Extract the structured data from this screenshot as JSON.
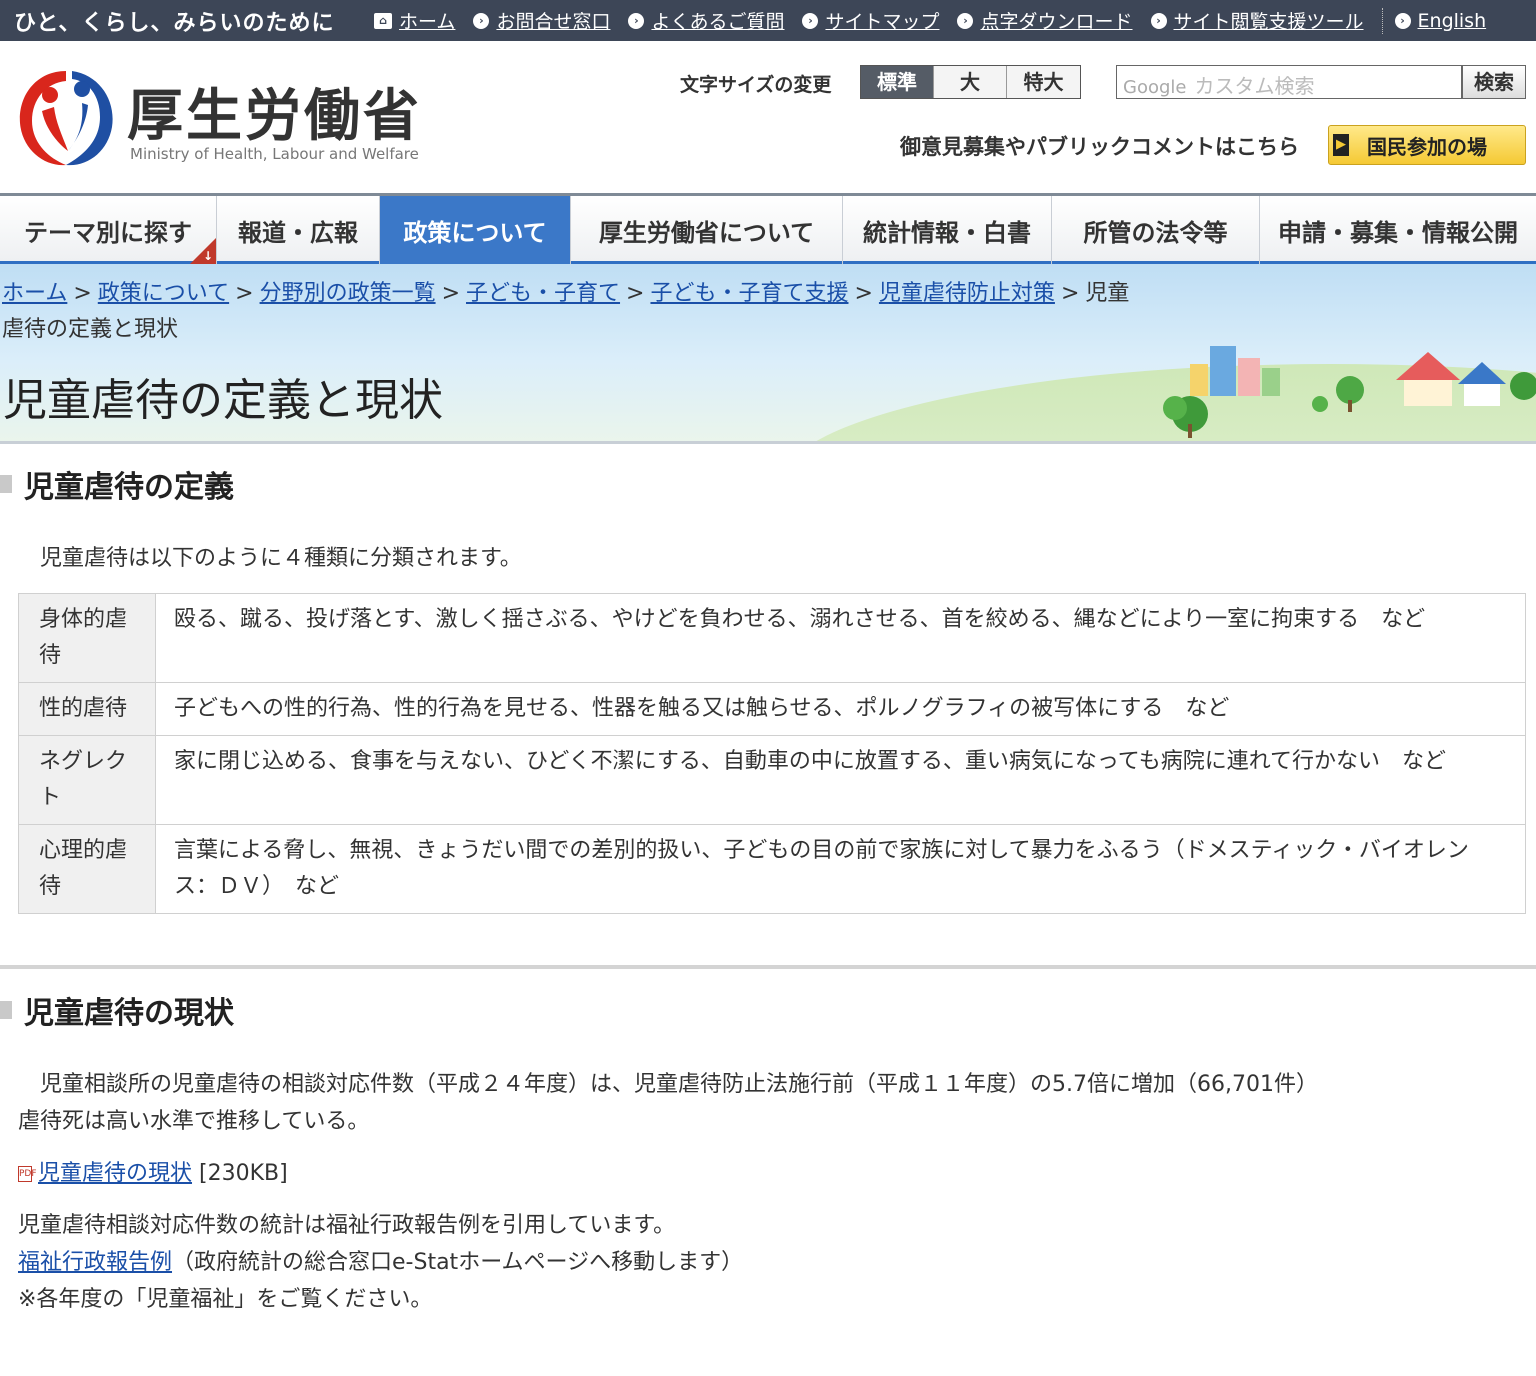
{
  "topbar": {
    "slogan": "ひと、くらし、みらいのために",
    "links": [
      {
        "label": "ホーム",
        "icon": "home-icon"
      },
      {
        "label": "お問合せ窓口",
        "icon": "circle-arrow-icon"
      },
      {
        "label": "よくあるご質問",
        "icon": "circle-arrow-icon"
      },
      {
        "label": "サイトマップ",
        "icon": "circle-arrow-icon"
      },
      {
        "label": "点字ダウンロード",
        "icon": "circle-arrow-icon"
      },
      {
        "label": "サイト閲覧支援ツール",
        "icon": "circle-arrow-icon"
      }
    ],
    "english": "English"
  },
  "header": {
    "title": "厚生労働省",
    "subtitle": "Ministry of Health, Labour and Welfare",
    "fontsize_label": "文字サイズの変更",
    "fontsize_options": [
      "標準",
      "大",
      "特大"
    ],
    "fontsize_selected": "標準",
    "search_brand": "Google",
    "search_placeholder": "カスタム検索",
    "search_button": "検索",
    "comment_text": "御意見募集やパブリックコメントはこちら",
    "kokumin_button": "国民参加の場"
  },
  "nav": {
    "items": [
      "テーマ別に探す",
      "報道・広報",
      "政策について",
      "厚生労働省について",
      "統計情報・白書",
      "所管の法令等",
      "申請・募集・情報公開"
    ],
    "active": "政策について"
  },
  "breadcrumb": {
    "links": [
      "ホーム",
      "政策について",
      "分野別の政策一覧",
      "子ども・子育て",
      "子ども・子育て支援",
      "児童虐待防止対策"
    ],
    "current": "児童虐待の定義と現状"
  },
  "page_title": "児童虐待の定義と現状",
  "section1": {
    "heading": "児童虐待の定義",
    "intro": "児童虐待は以下のように４種類に分類されます。",
    "rows": [
      {
        "type": "身体的虐待",
        "desc": "殴る、蹴る、投げ落とす、激しく揺さぶる、やけどを負わせる、溺れさせる、首を絞める、縄などにより一室に拘束する　など"
      },
      {
        "type": "性的虐待",
        "desc": "子どもへの性的行為、性的行為を見せる、性器を触る又は触らせる、ポルノグラフィの被写体にする　など"
      },
      {
        "type": "ネグレクト",
        "desc": "家に閉じ込める、食事を与えない、ひどく不潔にする、自動車の中に放置する、重い病気になっても病院に連れて行かない　など"
      },
      {
        "type": "心理的虐待",
        "desc": "言葉による脅し、無視、きょうだい間での差別的扱い、子どもの目の前で家族に対して暴力をふるう（ドメスティック・バイオレンス：ＤＶ）　など"
      }
    ]
  },
  "section2": {
    "heading": "児童虐待の現状",
    "para1": "児童相談所の児童虐待の相談対応件数（平成２４年度）は、児童虐待防止法施行前（平成１１年度）の5.7倍に増加（66,701件）",
    "para2": "虐待死は高い水準で推移している。",
    "pdf_link": "児童虐待の現状",
    "pdf_size": "[230KB]",
    "note1": "児童虐待相談対応件数の統計は福祉行政報告例を引用しています。",
    "note2_link": "福祉行政報告例",
    "note2_text": "（政府統計の総合窓口e-Statホームページへ移動します）",
    "note3": "※各年度の「児童福祉」をご覧ください。"
  },
  "colors": {
    "topbar_bg": "#3d4657",
    "nav_active": "#3b78c8",
    "link": "#1a4fa8",
    "accent_yellow": "#f5c934"
  }
}
